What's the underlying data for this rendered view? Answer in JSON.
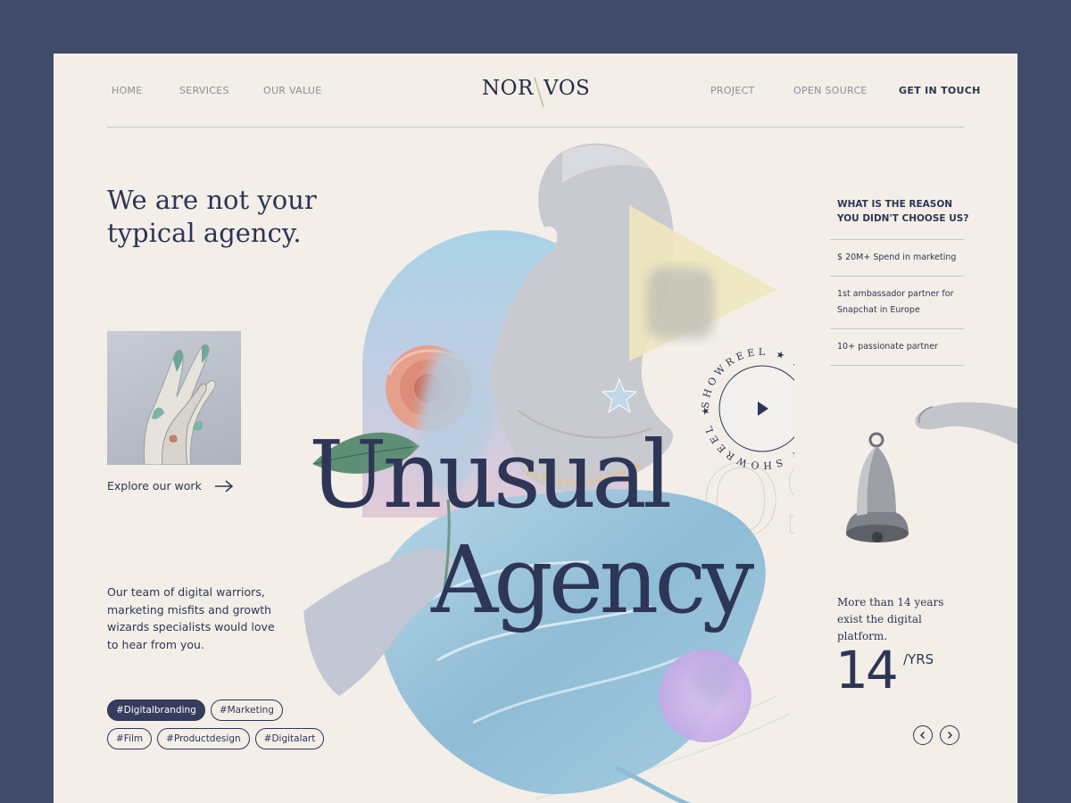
{
  "nav": {
    "left": [
      "HOME",
      "SERVICES",
      "OUR VALUE"
    ],
    "right": [
      "PROJECT",
      "OPEN SOURCE",
      "GET IN TOUCH"
    ],
    "logo_left": "NOR",
    "logo_right": "VOS"
  },
  "hero": {
    "headline": "We are not your typical agency.",
    "big_line1": "Unusual",
    "big_line2": "Agency",
    "showreel_text": "SHOWREEL ★ SHOWREEL ★ SHOWREEL ★"
  },
  "explore_label": "Explore our work",
  "description": "Our team of digital warriors, marketing misfits and growth wizards specialists would love to hear from you.",
  "tags": [
    "#Digitalbranding",
    "#Marketing",
    "#Film",
    "#Productdesign",
    "#Digitalart"
  ],
  "reasons": {
    "title": "WHAT IS THE REASON YOU DIDN'T CHOOSE US?",
    "items": [
      "$ 20M+ Spend in marketing",
      "1st ambassador partner for Snapchat in Europe",
      "10+ passionate partner"
    ]
  },
  "years": {
    "text": "More than 14 years exist the digital platform.",
    "number": "14",
    "unit": "/YRS"
  },
  "colors": {
    "outer_bg": "#414a69",
    "page_bg": "#f3efe8",
    "ink": "#2d3556",
    "accent_blue": "#8fb6cf",
    "accent_yellow": "#efe7bd"
  }
}
